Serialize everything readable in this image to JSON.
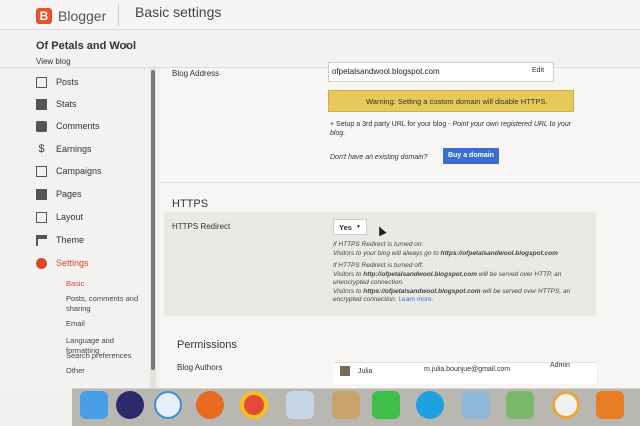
{
  "header": {
    "logo_letter": "B",
    "app_name": "Blogger",
    "page_title": "Basic settings"
  },
  "blog": {
    "name": "Of Petals and Wool",
    "view_label": "View blog"
  },
  "sidebar": {
    "items": [
      {
        "label": "Posts",
        "icon": "posts-icon"
      },
      {
        "label": "Stats",
        "icon": "stats-icon"
      },
      {
        "label": "Comments",
        "icon": "comments-icon"
      },
      {
        "label": "Earnings",
        "icon": "dollar-icon"
      },
      {
        "label": "Campaigns",
        "icon": "campaigns-icon"
      },
      {
        "label": "Pages",
        "icon": "pages-icon"
      },
      {
        "label": "Layout",
        "icon": "layout-icon"
      },
      {
        "label": "Theme",
        "icon": "paint-roller-icon"
      },
      {
        "label": "Settings",
        "icon": "gear-icon"
      }
    ],
    "subitems": [
      "Basic",
      "Posts, comments and sharing",
      "Email",
      "Language and formatting",
      "Search preferences",
      "Other"
    ]
  },
  "main": {
    "blog_address_label": "Blog Address",
    "blog_address_value": "ofpetalsandwool.blogspot.com",
    "edit_label": "Edit",
    "warning": "Warning: Setting a custom domain will disable HTTPS.",
    "setup_prefix": "+ Setup a 3rd party URL for your blog - ",
    "setup_italic": "Point your own registered URL to your blog.",
    "no_domain": "Don't have an existing domain?",
    "buy_domain": "Buy a domain",
    "https_heading": "HTTPS",
    "https_redirect_label": "HTTPS Redirect",
    "https_redirect_value": "Yes",
    "on_heading": "If HTTPS Redirect is turned on:",
    "on_text_prefix": "Visitors to your blog will always go to ",
    "on_text_url": "https://ofpetalsandwool.blogspot.com",
    "off_heading": "If HTTPS Redirect is turned off:",
    "off_text1_prefix": "Visitors to ",
    "off_text1_url": "http://ofpetalsandwool.blogspot.com",
    "off_text1_suffix": " will be served over HTTP, an unencrypted connection.",
    "off_text2_prefix": "Visitors to ",
    "off_text2_url": "https://ofpetalsandwool.blogspot.com",
    "off_text2_suffix": " will be served over HTTPS, an encrypted connection. ",
    "learn_more": "Learn more.",
    "permissions_heading": "Permissions",
    "blog_authors_label": "Blog Authors",
    "author_name": "Julia",
    "author_email": "m.julia.bounjue@gmail.com",
    "author_role": "Admin"
  },
  "dock": {
    "apps": [
      "finder-icon",
      "siri-icon",
      "safari-icon",
      "firefox-icon",
      "chrome-icon",
      "mail-icon",
      "notes-icon",
      "facetime-icon",
      "skype-icon",
      "preview-icon",
      "maps-icon",
      "photos-icon",
      "books-icon"
    ]
  },
  "colors": {
    "accent": "#e8532b",
    "active": "#d9462a",
    "warning_bg": "#e7c85a",
    "button_blue": "#3a6ecc"
  }
}
